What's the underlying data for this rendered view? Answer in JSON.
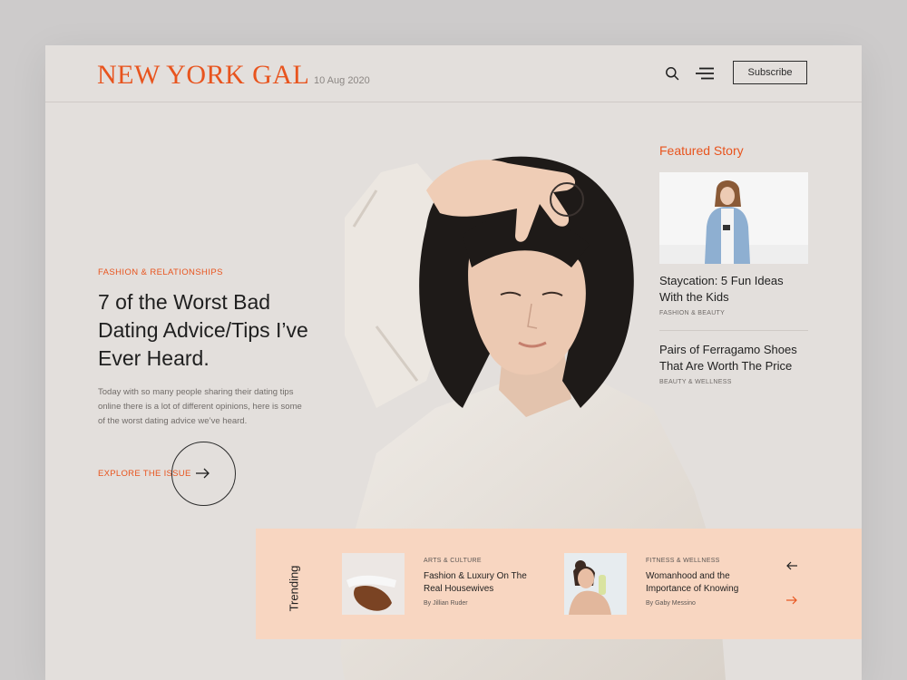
{
  "header": {
    "logo": "NEW YORK GAL",
    "date": "10 Aug 2020",
    "subscribe_label": "Subscribe"
  },
  "hero": {
    "category": "FASHION & RELATIONSHIPS",
    "headline": "7 of the Worst Bad Dating Advice/Tips I’ve Ever Heard.",
    "summary": "Today with so many people sharing their dating tips online there is a lot of different opinions, here is some of the worst dating advice we’ve heard.",
    "cta_label": "EXPLORE THE ISSUE"
  },
  "featured": {
    "heading": "Featured Story",
    "stories": [
      {
        "title": "Staycation: 5 Fun Ideas With the Kids",
        "category": "FASHION & BEAUTY"
      },
      {
        "title": "Pairs of Ferragamo Shoes That Are Worth The Price",
        "category": "BEAUTY & WELLNESS"
      }
    ]
  },
  "trending": {
    "label": "Trending",
    "items": [
      {
        "category": "ARTS & CULTURE",
        "title": "Fashion & Luxury On The Real Housewives",
        "author": "By Jillian  Ruder"
      },
      {
        "category": "FITNESS & WELLNESS",
        "title": "Womanhood and the Importance of Knowing",
        "author": "By Gaby Messino"
      }
    ]
  },
  "icons": [
    "search-icon",
    "menu-icon",
    "arrow-right-icon",
    "arrow-left-icon"
  ],
  "colors": {
    "accent": "#e8541e",
    "trending_bg": "#f8d6c1",
    "page_bg": "#e3dfdc"
  }
}
